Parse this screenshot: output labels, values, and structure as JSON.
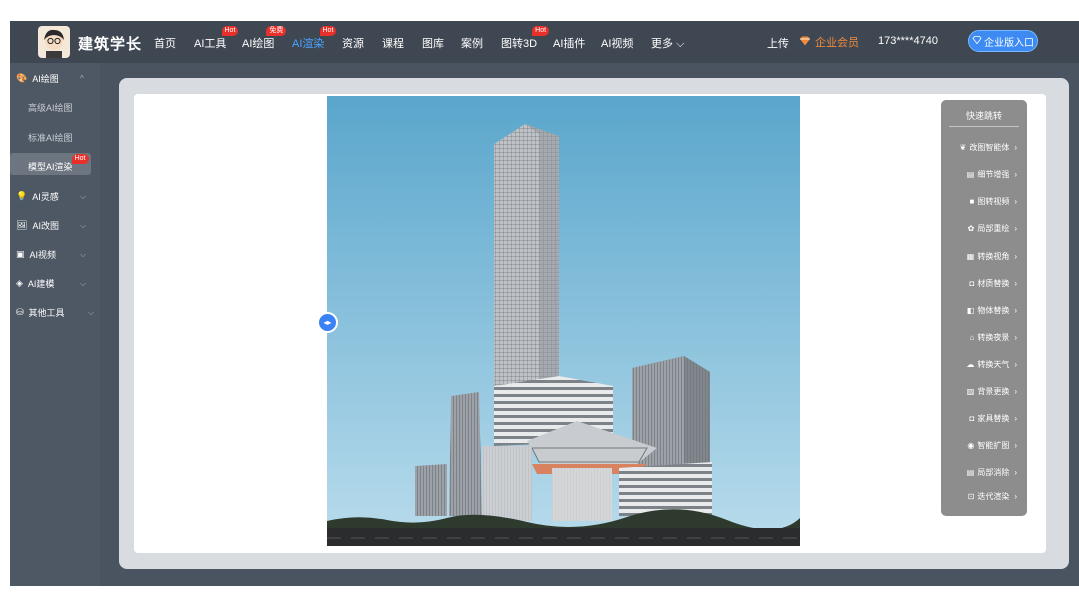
{
  "brand": {
    "name": "建筑学长"
  },
  "nav": {
    "items": [
      {
        "label": "首页",
        "badge": ""
      },
      {
        "label": "AI工具",
        "badge": "Hot"
      },
      {
        "label": "AI绘图",
        "badge": "免费"
      },
      {
        "label": "AI渲染",
        "badge": "Hot",
        "active": true
      },
      {
        "label": "资源",
        "badge": ""
      },
      {
        "label": "课程",
        "badge": ""
      },
      {
        "label": "图库",
        "badge": ""
      },
      {
        "label": "案例",
        "badge": ""
      },
      {
        "label": "图转3D",
        "badge": "Hot"
      },
      {
        "label": "AI插件",
        "badge": ""
      },
      {
        "label": "AI视频",
        "badge": ""
      },
      {
        "label": "更多",
        "badge": ""
      }
    ],
    "upload": "上传",
    "vip": "企业会员",
    "phone": "173****4740",
    "enterprise": "企业版入口"
  },
  "sidebar": {
    "groups": [
      {
        "label": "AI绘图",
        "icon": "palette-icon"
      },
      {
        "label": "AI灵感",
        "icon": "bulb-icon"
      },
      {
        "label": "AI改图",
        "icon": "image-edit-icon"
      },
      {
        "label": "AI视频",
        "icon": "video-icon"
      },
      {
        "label": "AI建模",
        "icon": "cube-icon"
      },
      {
        "label": "其他工具",
        "icon": "toolbox-icon"
      }
    ],
    "sub_items": [
      {
        "label": "高级AI绘图"
      },
      {
        "label": "标准AI绘图"
      },
      {
        "label": "模型AI渲染",
        "badge": "Hot"
      }
    ]
  },
  "quick_nav": {
    "title": "快速跳转",
    "items": [
      {
        "label": "改图智能体",
        "icon": "agent-icon"
      },
      {
        "label": "细节增强",
        "icon": "enhance-icon"
      },
      {
        "label": "图转视频",
        "icon": "video-icon"
      },
      {
        "label": "局部重绘",
        "icon": "repaint-icon"
      },
      {
        "label": "转换视角",
        "icon": "view-icon"
      },
      {
        "label": "材质替换",
        "icon": "material-icon"
      },
      {
        "label": "物体替换",
        "icon": "object-icon"
      },
      {
        "label": "转换夜景",
        "icon": "night-icon"
      },
      {
        "label": "转换天气",
        "icon": "weather-icon"
      },
      {
        "label": "背景更换",
        "icon": "background-icon"
      },
      {
        "label": "家具替换",
        "icon": "furniture-icon"
      },
      {
        "label": "智能扩图",
        "icon": "expand-icon"
      },
      {
        "label": "局部消除",
        "icon": "erase-icon"
      },
      {
        "label": "迭代渲染",
        "icon": "iterate-icon"
      }
    ]
  },
  "colors": {
    "accent": "#3d8bf2",
    "hot": "#e8302a",
    "vip": "#f28a3a"
  }
}
